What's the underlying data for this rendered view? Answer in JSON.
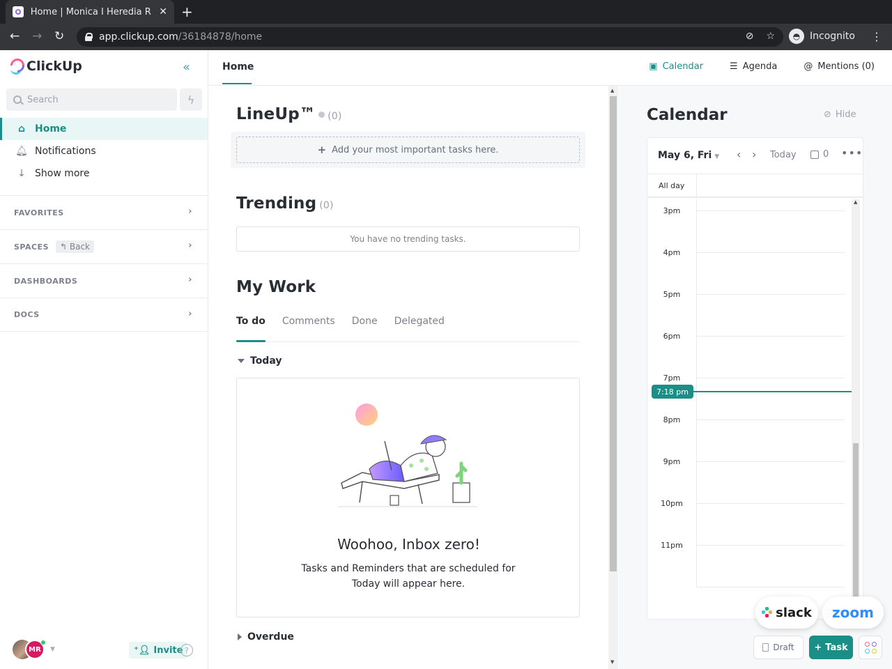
{
  "browser": {
    "tab_title": "Home | Monica I Heredia R",
    "url_host": "app.clickup.com",
    "url_path": "/36184878/home",
    "incognito_label": "Incognito"
  },
  "sidebar": {
    "logo_text": "ClickUp",
    "search_placeholder": "Search",
    "nav": [
      {
        "label": "Home",
        "icon": "home-icon",
        "active": true
      },
      {
        "label": "Notifications",
        "icon": "bell-icon"
      },
      {
        "label": "Show more",
        "icon": "arrow-down-icon"
      }
    ],
    "sections": [
      {
        "label": "FAVORITES"
      },
      {
        "label": "SPACES",
        "badge": "Back"
      },
      {
        "label": "DASHBOARDS"
      },
      {
        "label": "DOCS"
      }
    ],
    "user_initials": "MR",
    "invite_label": "Invite"
  },
  "header": {
    "page_tab": "Home",
    "actions": [
      {
        "label": "Calendar",
        "icon": "calendar-icon",
        "active": true
      },
      {
        "label": "Agenda",
        "icon": "list-icon"
      },
      {
        "label": "Mentions (0)",
        "icon": "at-icon"
      }
    ]
  },
  "main": {
    "lineup": {
      "title": "LineUp™",
      "count": "(0)",
      "add_label": "Add your most important tasks here."
    },
    "trending": {
      "title": "Trending",
      "count": "(0)",
      "empty": "You have no trending tasks."
    },
    "my_work": {
      "title": "My Work",
      "tabs": [
        "To do",
        "Comments",
        "Done",
        "Delegated"
      ],
      "active_tab": "To do",
      "group_today": "Today",
      "empty_title": "Woohoo, Inbox zero!",
      "empty_desc": "Tasks and Reminders that are scheduled for Today will appear here.",
      "group_overdue": "Overdue"
    }
  },
  "calendar": {
    "title": "Calendar",
    "hide_label": "Hide",
    "date_label": "May 6, Fri",
    "today_label": "Today",
    "event_count": "0",
    "allday_label": "All day",
    "hours": [
      "3pm",
      "4pm",
      "5pm",
      "6pm",
      "7pm",
      "8pm",
      "9pm",
      "10pm",
      "11pm"
    ],
    "now_label": "7:18 pm"
  },
  "floating": {
    "slack": "slack",
    "zoom": "zoom",
    "draft": "Draft",
    "task": "Task"
  },
  "colors": {
    "accent": "#1b8f87",
    "brand_pink": "#ff5c8a",
    "brand_purple": "#7b68ee"
  }
}
